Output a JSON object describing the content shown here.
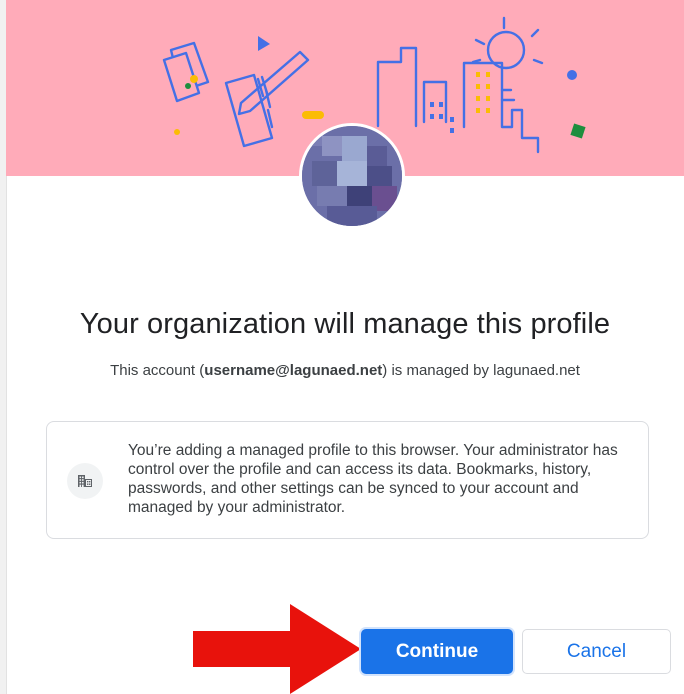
{
  "dialog": {
    "title": "Your organization will manage this profile",
    "subtitle_prefix": "This account (",
    "account_email": "username@lagunaed.net",
    "subtitle_suffix": ") is managed by lagunaed.net",
    "notice_text": "You’re adding a managed profile to this browser. Your administrator has control over the profile and can access its data. Bookmarks, history, passwords, and other settings can be synced to your account and managed by your administrator.",
    "notice_icon": "business-building-icon"
  },
  "buttons": {
    "continue_label": "Continue",
    "cancel_label": "Cancel"
  },
  "colors": {
    "banner": "#ffabb9",
    "accent": "#1a73e8",
    "annotation_arrow": "#e8120c",
    "avatar": "#6b6fa8"
  }
}
